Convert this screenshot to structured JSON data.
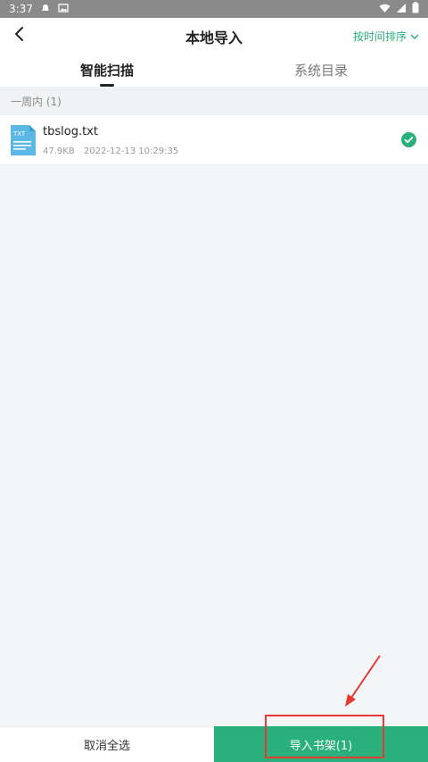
{
  "status_bar": {
    "time": "3:37",
    "icons": [
      "notification-icon",
      "image-icon",
      "wifi-icon",
      "signal-icon",
      "battery-icon"
    ]
  },
  "header": {
    "title": "本地导入",
    "sort_label": "按时间排序",
    "back_icon": "chevron-left-icon",
    "sort_icon": "chevron-down-icon"
  },
  "tabs": [
    {
      "label": "智能扫描",
      "active": true
    },
    {
      "label": "系统目录",
      "active": false
    }
  ],
  "section": {
    "label": "一周内 (1)"
  },
  "files": [
    {
      "icon_text": "TXT",
      "name": "tbslog.txt",
      "size": "47.9KB",
      "date": "2022-12-13 10:29:35",
      "selected": true
    }
  ],
  "bottom_bar": {
    "cancel_label": "取消全选",
    "import_label": "导入书架(1)"
  },
  "colors": {
    "accent": "#2ab07b",
    "annotation": "#e53935",
    "file_icon": "#5bb7e6"
  }
}
